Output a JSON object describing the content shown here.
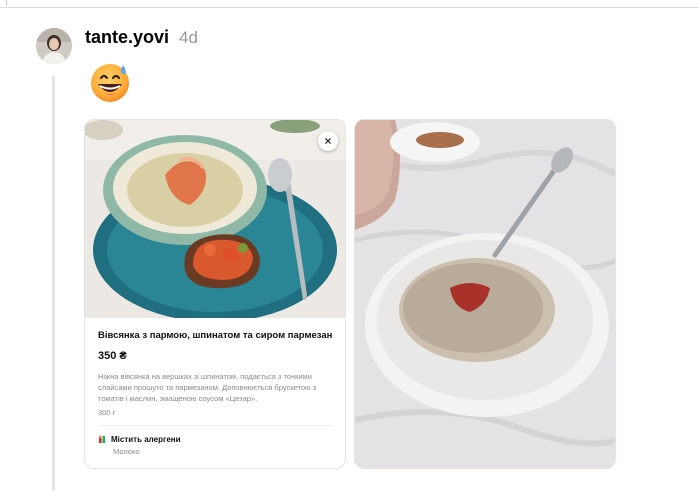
{
  "post": {
    "username": "tante.yovi",
    "time_ago": "4d",
    "emoji": "grinning-face-with-sweat"
  },
  "menu_card": {
    "title": "Вівсянка з пармою, шпинатом та сиром пармезан",
    "price": "350 ₴",
    "description": "Ніжна вівсянка на вершках зі шпинатом, подається з тонкими слайсами прошуто та  пармезаном. Доповнюється брускетою з томатів і маслин, змащеною соусом «Цезар».",
    "weight": "300 г",
    "allergen_label": "Містить алергени",
    "allergen_value": "Молоко",
    "close_symbol": "×"
  },
  "colors": {
    "plate_blue": "#1d6a7a",
    "porridge": "#d9cfa4",
    "salmon": "#e0764a",
    "background": "#ffffff",
    "timestamp_gray": "#999999"
  },
  "icons": [
    "close-icon",
    "allergen-icon",
    "grinning-face-with-sweat-emoji"
  ]
}
